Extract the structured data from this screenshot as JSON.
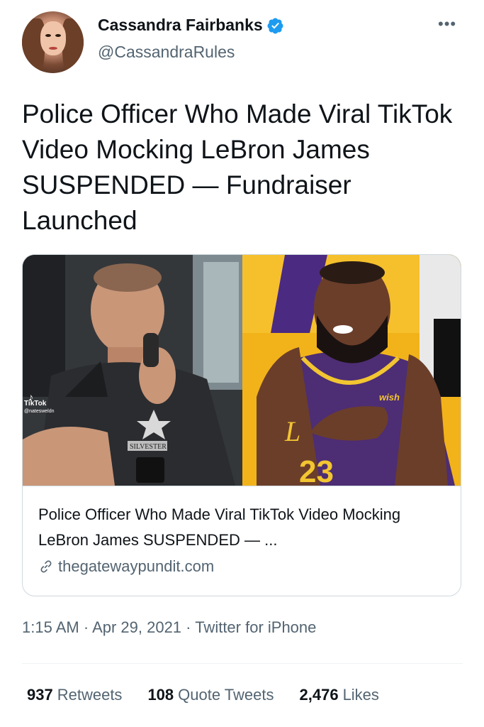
{
  "author": {
    "name": "Cassandra Fairbanks",
    "handle": "@CassandraRules",
    "verified": true,
    "avatar_icon": "profile-photo"
  },
  "more_icon": "more-options-icon",
  "tweet": {
    "text": "Police Officer Who Made Viral TikTok Video Mocking LeBron James SUSPENDED — Fundraiser Launched"
  },
  "card": {
    "image_left_overlay": {
      "tiktok_label": "TikTok",
      "tiktok_user": "@natesweldn",
      "badge_text": "SILVESTER"
    },
    "image_right_overlay": {
      "jersey_sponsor": "wish",
      "jersey_number": "23"
    },
    "title": "Police Officer Who Made Viral TikTok Video Mocking LeBron James SUSPENDED — ...",
    "domain": "thegatewaypundit.com",
    "link_icon": "link-icon"
  },
  "meta": {
    "time": "1:15 AM",
    "date": "Apr 29, 2021",
    "source": "Twitter for iPhone",
    "separator": " · "
  },
  "stats": {
    "retweets_count": "937",
    "retweets_label": "Retweets",
    "quotes_count": "108",
    "quotes_label": "Quote Tweets",
    "likes_count": "2,476",
    "likes_label": "Likes"
  },
  "colors": {
    "verified_blue": "#1d9bf0",
    "text_primary": "#0f1419",
    "text_secondary": "#536471",
    "border": "#cfd9de"
  }
}
